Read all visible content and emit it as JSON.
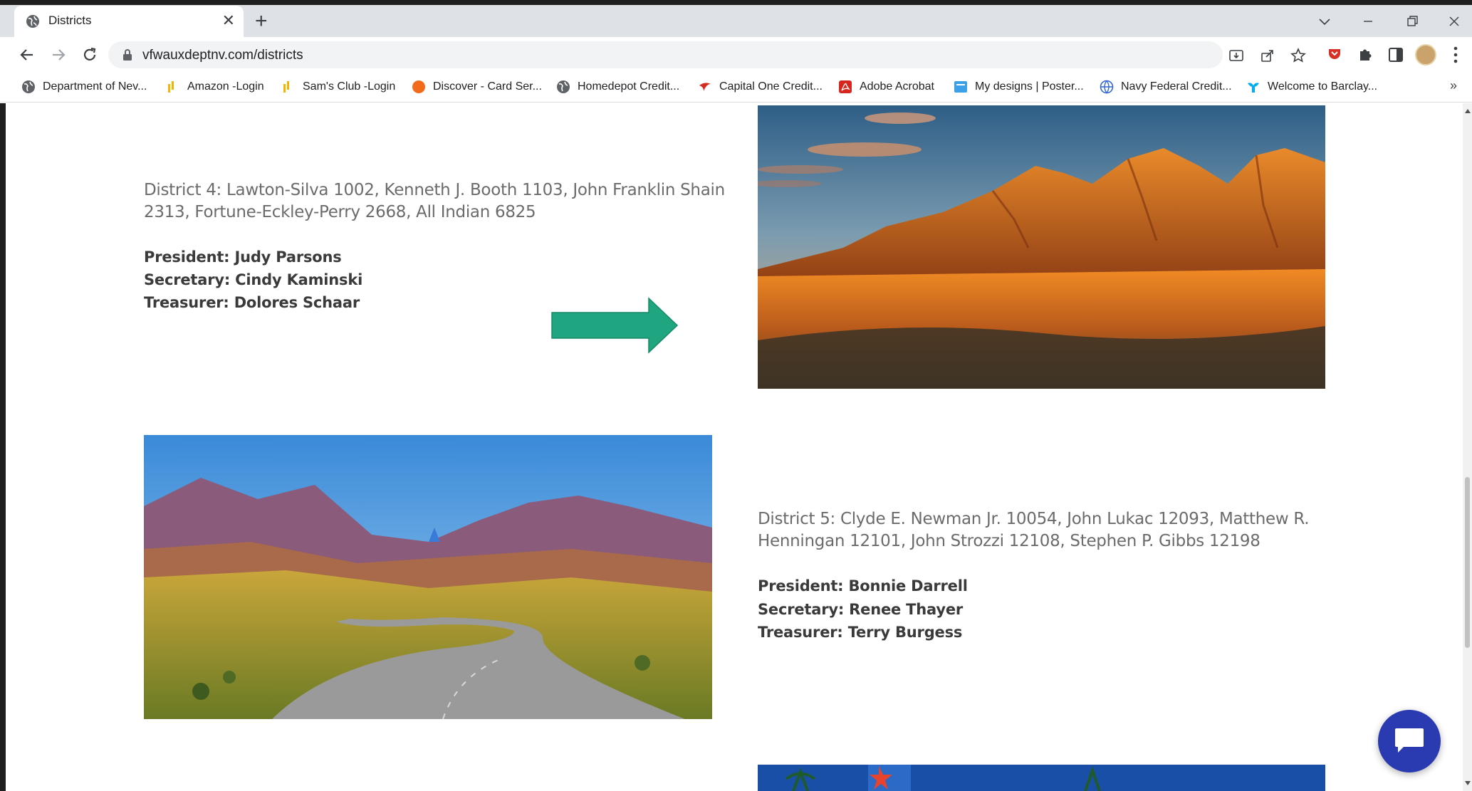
{
  "browser": {
    "tab": {
      "title": "Districts"
    },
    "url": "vfwauxdeptnv.com/districts",
    "bookmarks": [
      {
        "label": "Department of Nev...",
        "icon": "globe-icon"
      },
      {
        "label": "Amazon -Login",
        "icon": "bookmark-bars-icon"
      },
      {
        "label": "Sam's Club -Login",
        "icon": "bookmark-bars-icon"
      },
      {
        "label": "Discover - Card Ser...",
        "icon": "discover-logo-icon"
      },
      {
        "label": "Homedepot Credit...",
        "icon": "globe-icon"
      },
      {
        "label": "Capital One Credit...",
        "icon": "capital-one-logo-icon"
      },
      {
        "label": "Adobe Acrobat",
        "icon": "acrobat-icon"
      },
      {
        "label": "My designs | Poster...",
        "icon": "postermywall-icon"
      },
      {
        "label": "Navy Federal Credit...",
        "icon": "globe-icon"
      },
      {
        "label": "Welcome to Barclay...",
        "icon": "barclays-eagle-icon"
      }
    ]
  },
  "districts": [
    {
      "description": "District 4: Lawton-Silva 1002, Kenneth J. Booth 1103, John Franklin Shain 2313, Fortune-Eckley-Perry 2668, All Indian 6825",
      "president": "President: Judy Parsons",
      "secretary": "Secretary: Cindy Kaminski",
      "treasurer": "Treasurer: Dolores Schaar"
    },
    {
      "description": "District 5: Clyde E. Newman Jr. 10054, John Lukac 12093, Matthew R. Henningan 12101, John Strozzi 12108, Stephen P. Gibbs 12198",
      "president": "President: Bonnie Darrell",
      "secretary": "Secretary: Renee Thayer",
      "treasurer": "Treasurer: Terry Burgess"
    }
  ],
  "colors": {
    "arrow": "#1fa57f",
    "chat": "#2a3ab0"
  }
}
